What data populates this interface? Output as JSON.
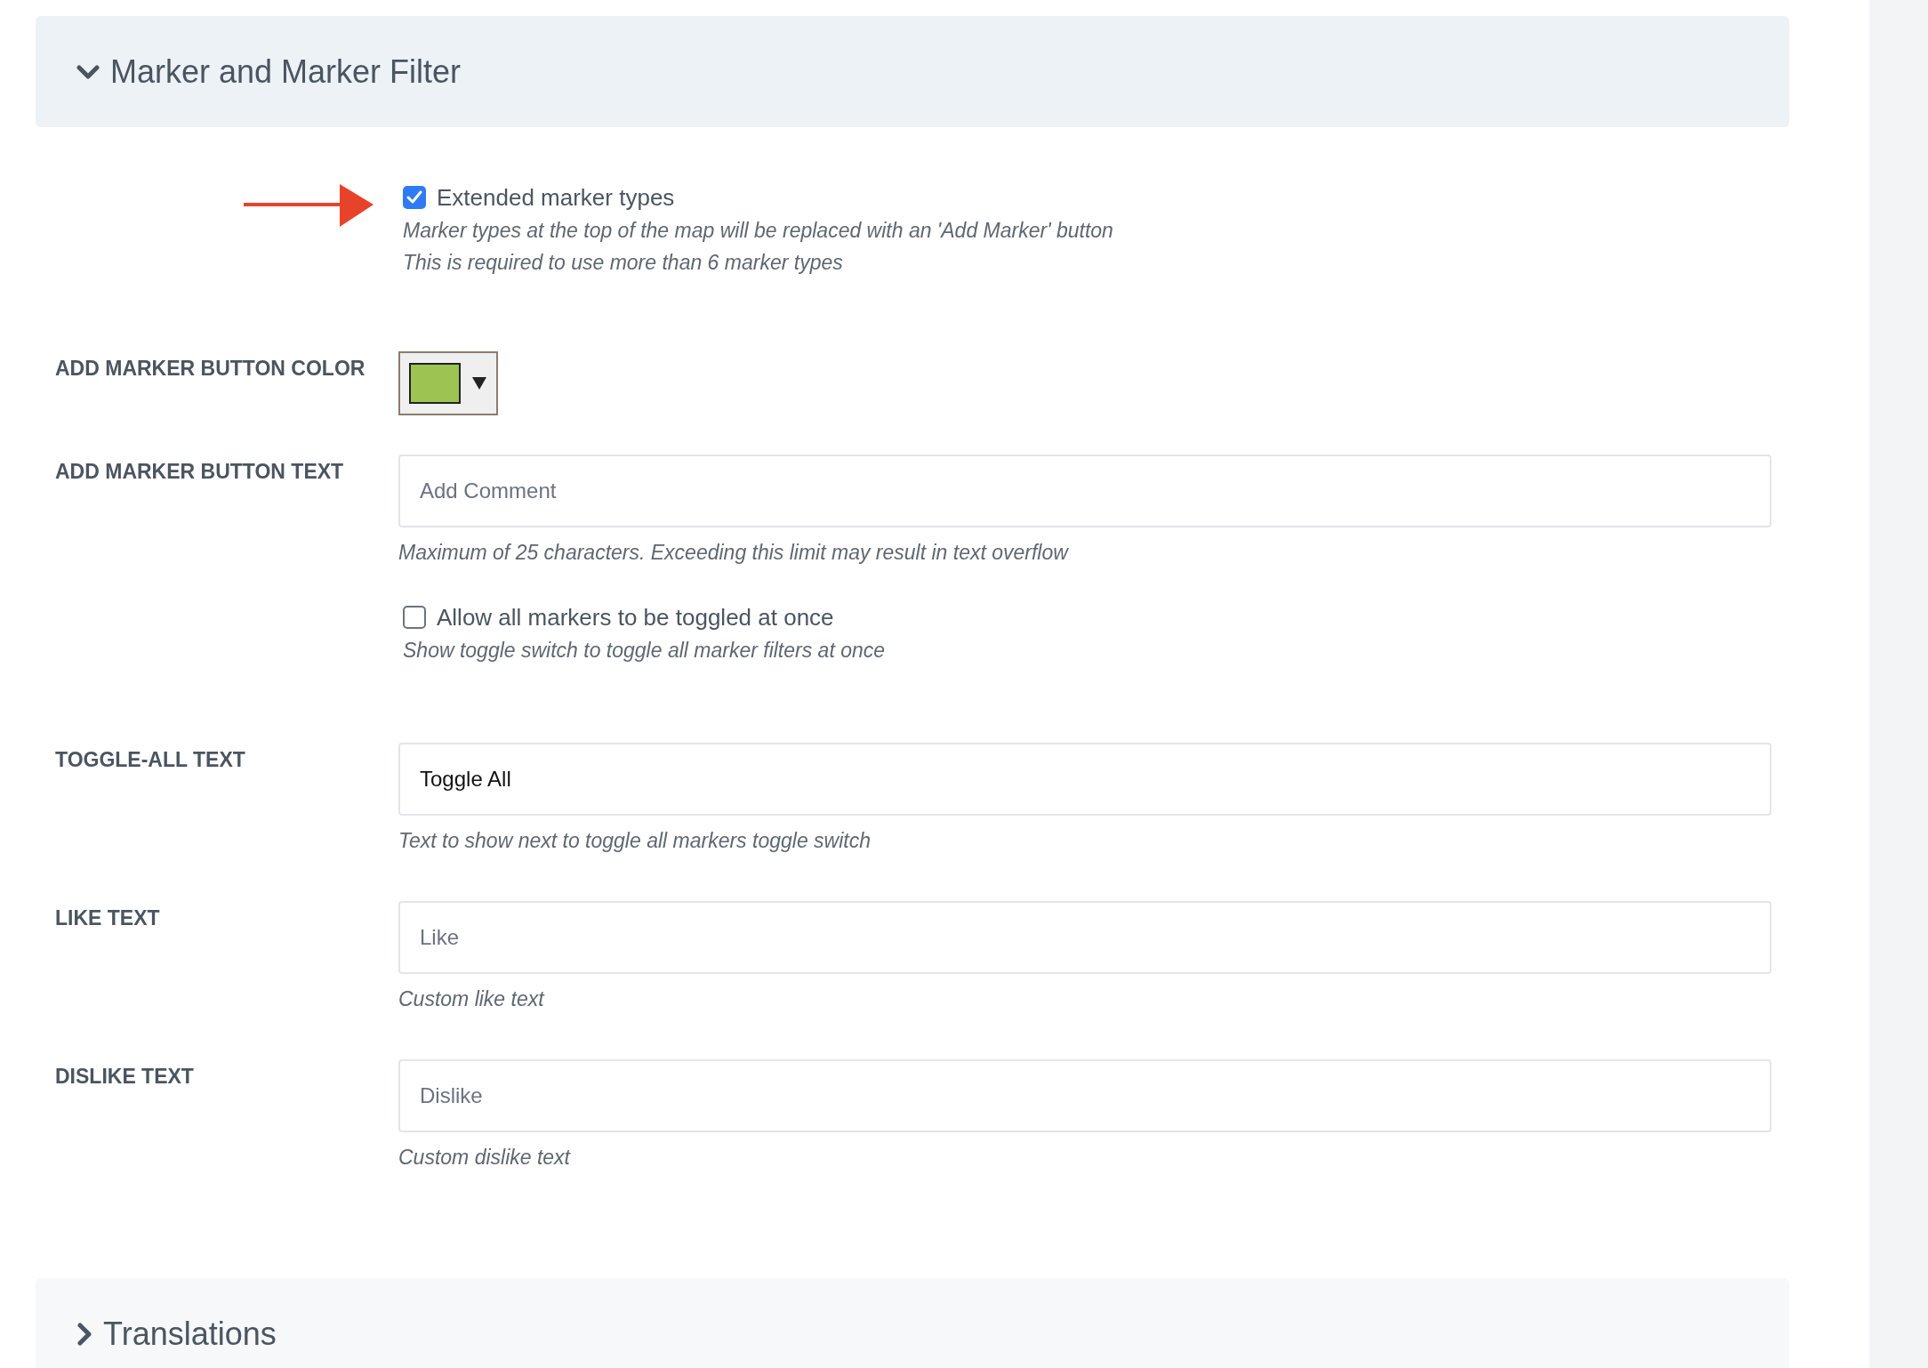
{
  "sections": [
    {
      "title": "Marker and Marker Filter",
      "expanded": true,
      "rows": [
        {
          "kind": "checkbox",
          "label": "Extended marker types",
          "checked": true,
          "pointer": true,
          "hints": [
            "Marker types at the top of the map will be replaced with an 'Add Marker' button",
            "This is required to use more than 6 marker types"
          ]
        },
        {
          "kind": "color",
          "label": "ADD MARKER BUTTON COLOR",
          "color": "#9dc452"
        },
        {
          "kind": "text",
          "label": "ADD MARKER BUTTON TEXT",
          "placeholder": "Add Comment",
          "hints": [
            "Maximum of 25 characters. Exceeding this limit may result in text overflow"
          ]
        },
        {
          "kind": "checkbox",
          "label": "Allow all markers to be toggled at once",
          "checked": false,
          "pointer": false,
          "hints": [
            "Show toggle switch to toggle all marker filters at once"
          ]
        },
        {
          "kind": "text",
          "label": "TOGGLE-ALL TEXT",
          "value": "Toggle All",
          "hints": [
            "Text to show next to toggle all markers toggle switch"
          ]
        },
        {
          "kind": "text",
          "label": "LIKE TEXT",
          "placeholder": "Like",
          "hints": [
            "Custom like text"
          ]
        },
        {
          "kind": "text",
          "label": "DISLIKE TEXT",
          "placeholder": "Dislike",
          "hints": [
            "Custom dislike text"
          ]
        }
      ]
    },
    {
      "title": "Translations",
      "expanded": false
    }
  ]
}
